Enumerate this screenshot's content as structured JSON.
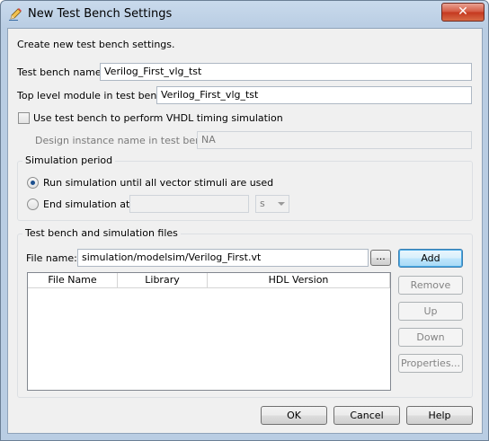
{
  "window": {
    "title": "New Test Bench Settings",
    "close_label": "✕"
  },
  "intro": "Create new test bench settings.",
  "test_bench_name": {
    "label": "Test bench name:",
    "value": "Verilog_First_vlg_tst"
  },
  "top_level_module": {
    "label": "Top level module in test bench:",
    "value": "Verilog_First_vlg_tst"
  },
  "vhdl_timing": {
    "label": "Use test bench to perform VHDL timing simulation",
    "checked": false
  },
  "design_instance": {
    "label": "Design instance name in test bench:",
    "value": "NA"
  },
  "simulation_period": {
    "title": "Simulation period",
    "run_until_label": "Run simulation until all vector stimuli are used",
    "end_at_label": "End simulation at:",
    "end_value": "",
    "unit": "s"
  },
  "files": {
    "title": "Test bench and simulation files",
    "file_name_label": "File name:",
    "file_name_value": "simulation/modelsim/Verilog_First.vt",
    "browse_label": "...",
    "columns": [
      "File Name",
      "Library",
      "HDL Version"
    ],
    "rows": []
  },
  "side_buttons": {
    "add": "Add",
    "remove": "Remove",
    "up": "Up",
    "down": "Down",
    "properties": "Properties..."
  },
  "footer": {
    "ok": "OK",
    "cancel": "Cancel",
    "help": "Help"
  }
}
